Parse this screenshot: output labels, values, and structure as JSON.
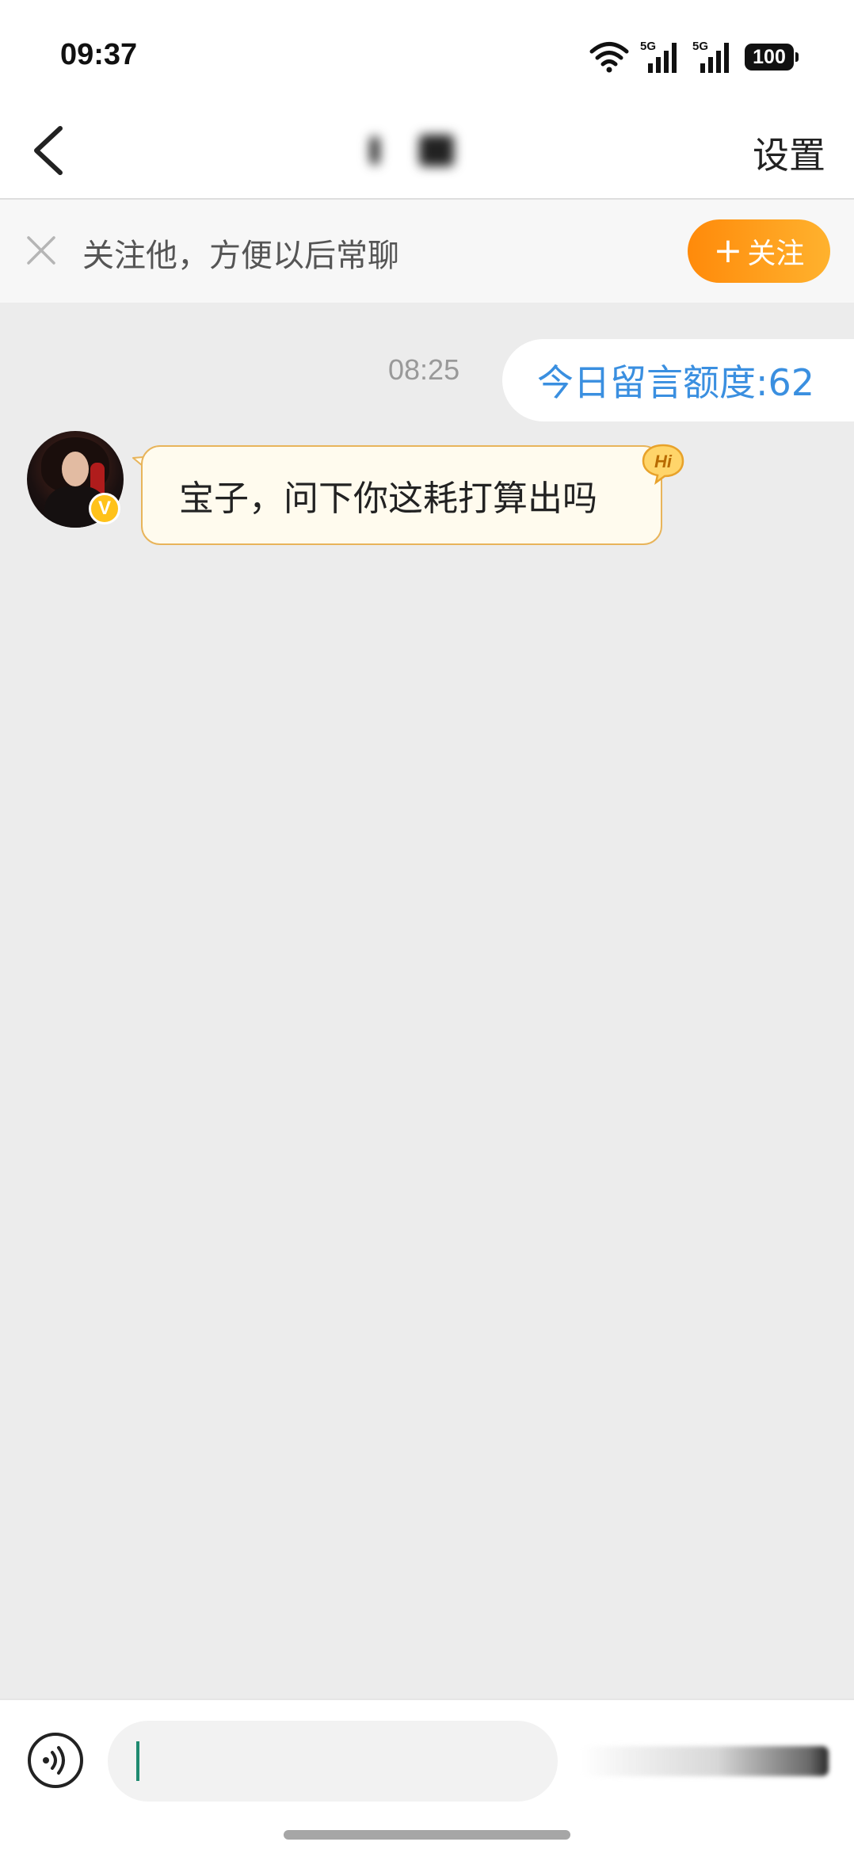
{
  "status_bar": {
    "time": "09:37",
    "network_1": "5G",
    "network_2": "5G",
    "battery": "100",
    "icons": [
      "wifi-icon",
      "signal-icon",
      "signal-icon",
      "battery-icon"
    ]
  },
  "nav": {
    "back_icon": "chevron-left-icon",
    "title_blurred": true,
    "settings_label": "设置"
  },
  "follow_banner": {
    "close_icon": "close-icon",
    "text": "关注他，方便以后常聊",
    "follow_plus": "+",
    "follow_label": "关注",
    "follow_color_start": "#ff8a0a",
    "follow_color_end": "#ffb22e"
  },
  "chat": {
    "timestamp": "08:25",
    "quota_text": "今日留言额度:62",
    "quota_color": "#3a8fe0",
    "messages": [
      {
        "sender": "other",
        "avatar_icon": "avatar",
        "verified_badge": "V",
        "hi_badge": "Hi",
        "text": "宝子，问下你这耗打算出吗"
      }
    ]
  },
  "input_bar": {
    "voice_icon": "voice-icon",
    "input_value": "",
    "cursor_color": "#1f8a70"
  }
}
